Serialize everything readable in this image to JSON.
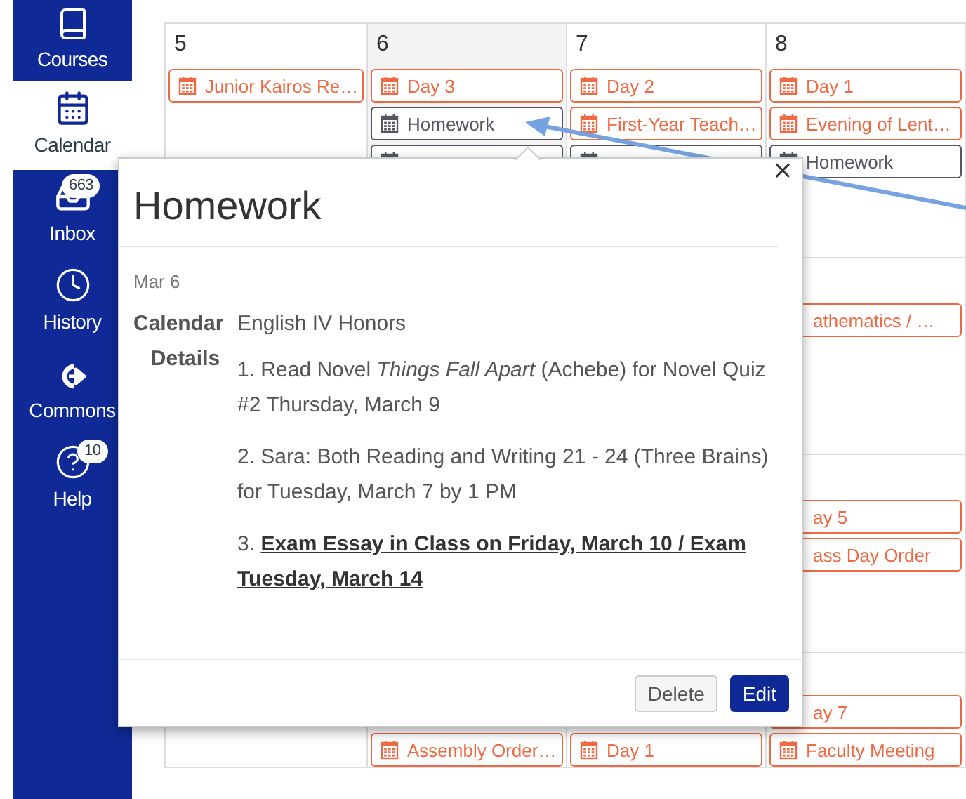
{
  "sidebar": {
    "items": [
      {
        "label": "Courses",
        "kind": "book",
        "selected": false
      },
      {
        "label": "Calendar",
        "kind": "calendar",
        "selected": true
      },
      {
        "label": "Inbox",
        "kind": "inbox",
        "selected": false,
        "badge": "663"
      },
      {
        "label": "History",
        "kind": "clock",
        "selected": false
      },
      {
        "label": "Commons",
        "kind": "commons",
        "selected": false
      },
      {
        "label": "Help",
        "kind": "help",
        "selected": false,
        "badge": "10"
      }
    ]
  },
  "calendar": {
    "weeks": [
      {
        "days": [
          {
            "number": "5",
            "today": false,
            "events": [
              {
                "kind": "full",
                "title": "Junior Kairos Re…",
                "color": "#ef6a44"
              }
            ]
          },
          {
            "number": "6",
            "today": true,
            "events": [
              {
                "kind": "full",
                "title": "Day 3",
                "color": "#ef6a44"
              },
              {
                "kind": "full",
                "title": "Homework",
                "color": "#55555f"
              },
              {
                "kind": "covered",
                "color": "#55555f"
              }
            ]
          },
          {
            "number": "7",
            "today": false,
            "events": [
              {
                "kind": "full",
                "title": "Day 2",
                "color": "#ef6a44"
              },
              {
                "kind": "full",
                "title": "First-Year Teach…",
                "color": "#ef6a44"
              },
              {
                "kind": "covered",
                "color": "#55555f"
              }
            ]
          },
          {
            "number": "8",
            "today": false,
            "events": [
              {
                "kind": "full",
                "title": "Day 1",
                "color": "#ef6a44"
              },
              {
                "kind": "full",
                "title": "Evening of Lent…",
                "color": "#ef6a44"
              },
              {
                "kind": "full",
                "title": "Homework",
                "color": "#55555f"
              }
            ]
          }
        ]
      },
      {
        "days": [
          {
            "today": false,
            "events": [
              {
                "kind": "clipped",
                "title": "athematics / …",
                "color": "#ef6a44"
              }
            ]
          }
        ]
      },
      {
        "days": [
          {
            "today": false,
            "events": [
              {
                "kind": "clipped",
                "title": "ay 5",
                "color": "#ef6a44"
              },
              {
                "kind": "clipped",
                "title": "ass Day Order",
                "color": "#ef6a44"
              }
            ]
          }
        ]
      },
      {
        "days": [
          {
            "today": false,
            "events": [
              {
                "kind": "full",
                "title": "Assembly Order…",
                "color": "#ef6a44"
              }
            ]
          },
          {
            "today": false,
            "events": [
              {
                "kind": "full",
                "title": "Day 1",
                "color": "#ef6a44"
              }
            ]
          },
          {
            "today": false,
            "events": [
              {
                "kind": "clipped",
                "title": "ay 7",
                "color": "#ef6a44"
              },
              {
                "kind": "full",
                "title": "Faculty Meeting",
                "color": "#ef6a44"
              }
            ]
          }
        ]
      }
    ]
  },
  "popover": {
    "title": "Homework",
    "close": "×",
    "date": "Mar 6",
    "calendar_label": "Calendar",
    "calendar_value": "English IV Honors",
    "details_label": "Details",
    "details": [
      "1. Read Novel *Things Fall Apart* (Achebe) for Novel Quiz #2 Thursday, March 9",
      "2. Sara: Both Reading and Writing 21 - 24 (Three Brains) for Tuesday, March 7 by 1 PM",
      "3. **Exam Essay in Class on Friday, March 10 / Exam Tuesday, March 14**"
    ],
    "buttons": [
      {
        "label": "Delete",
        "kind": "secondary"
      },
      {
        "label": "Edit",
        "kind": "primary"
      }
    ]
  }
}
